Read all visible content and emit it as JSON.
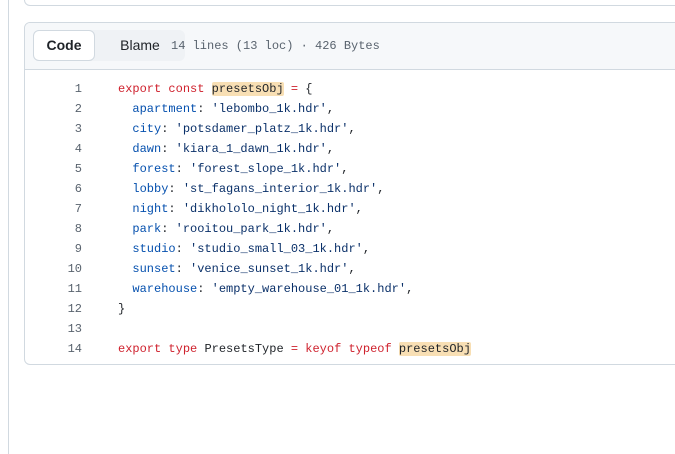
{
  "file_header": {
    "code_tab": "Code",
    "blame_tab": "Blame",
    "info": "14 lines (13 loc) · 426 Bytes"
  },
  "code": {
    "lines": [
      {
        "n": "1",
        "parts": [
          {
            "t": "export",
            "c": "kw"
          },
          {
            "t": " "
          },
          {
            "t": "const",
            "c": "kw"
          },
          {
            "t": " "
          },
          {
            "t": "presetsObj",
            "c": "ent hl"
          },
          {
            "t": " "
          },
          {
            "t": "=",
            "c": "kw"
          },
          {
            "t": " {"
          }
        ]
      },
      {
        "n": "2",
        "parts": [
          {
            "t": "  "
          },
          {
            "t": "apartment",
            "c": "key"
          },
          {
            "t": ": "
          },
          {
            "t": "'lebombo_1k.hdr'",
            "c": "str"
          },
          {
            "t": ","
          }
        ]
      },
      {
        "n": "3",
        "parts": [
          {
            "t": "  "
          },
          {
            "t": "city",
            "c": "key"
          },
          {
            "t": ": "
          },
          {
            "t": "'potsdamer_platz_1k.hdr'",
            "c": "str"
          },
          {
            "t": ","
          }
        ]
      },
      {
        "n": "4",
        "parts": [
          {
            "t": "  "
          },
          {
            "t": "dawn",
            "c": "key"
          },
          {
            "t": ": "
          },
          {
            "t": "'kiara_1_dawn_1k.hdr'",
            "c": "str"
          },
          {
            "t": ","
          }
        ]
      },
      {
        "n": "5",
        "parts": [
          {
            "t": "  "
          },
          {
            "t": "forest",
            "c": "key"
          },
          {
            "t": ": "
          },
          {
            "t": "'forest_slope_1k.hdr'",
            "c": "str"
          },
          {
            "t": ","
          }
        ]
      },
      {
        "n": "6",
        "parts": [
          {
            "t": "  "
          },
          {
            "t": "lobby",
            "c": "key"
          },
          {
            "t": ": "
          },
          {
            "t": "'st_fagans_interior_1k.hdr'",
            "c": "str"
          },
          {
            "t": ","
          }
        ]
      },
      {
        "n": "7",
        "parts": [
          {
            "t": "  "
          },
          {
            "t": "night",
            "c": "key"
          },
          {
            "t": ": "
          },
          {
            "t": "'dikhololo_night_1k.hdr'",
            "c": "str"
          },
          {
            "t": ","
          }
        ]
      },
      {
        "n": "8",
        "parts": [
          {
            "t": "  "
          },
          {
            "t": "park",
            "c": "key"
          },
          {
            "t": ": "
          },
          {
            "t": "'rooitou_park_1k.hdr'",
            "c": "str"
          },
          {
            "t": ","
          }
        ]
      },
      {
        "n": "9",
        "parts": [
          {
            "t": "  "
          },
          {
            "t": "studio",
            "c": "key"
          },
          {
            "t": ": "
          },
          {
            "t": "'studio_small_03_1k.hdr'",
            "c": "str"
          },
          {
            "t": ","
          }
        ]
      },
      {
        "n": "10",
        "parts": [
          {
            "t": "  "
          },
          {
            "t": "sunset",
            "c": "key"
          },
          {
            "t": ": "
          },
          {
            "t": "'venice_sunset_1k.hdr'",
            "c": "str"
          },
          {
            "t": ","
          }
        ]
      },
      {
        "n": "11",
        "parts": [
          {
            "t": "  "
          },
          {
            "t": "warehouse",
            "c": "key"
          },
          {
            "t": ": "
          },
          {
            "t": "'empty_warehouse_01_1k.hdr'",
            "c": "str"
          },
          {
            "t": ","
          }
        ]
      },
      {
        "n": "12",
        "parts": [
          {
            "t": "}"
          }
        ]
      },
      {
        "n": "13",
        "parts": []
      },
      {
        "n": "14",
        "parts": [
          {
            "t": "export",
            "c": "kw"
          },
          {
            "t": " "
          },
          {
            "t": "type",
            "c": "kw"
          },
          {
            "t": " "
          },
          {
            "t": "PresetsType",
            "c": "ent"
          },
          {
            "t": " "
          },
          {
            "t": "=",
            "c": "kw"
          },
          {
            "t": " "
          },
          {
            "t": "keyof",
            "c": "kw"
          },
          {
            "t": " "
          },
          {
            "t": "typeof",
            "c": "kw"
          },
          {
            "t": " "
          },
          {
            "t": "presetsObj",
            "c": "ent hl"
          }
        ]
      }
    ]
  },
  "colors": {
    "keyword": "#cf222e",
    "property": "#0550ae",
    "string": "#0a3069",
    "highlight": "#f8dfb4",
    "line_number": "#59636e",
    "border": "#d1d9e0"
  }
}
